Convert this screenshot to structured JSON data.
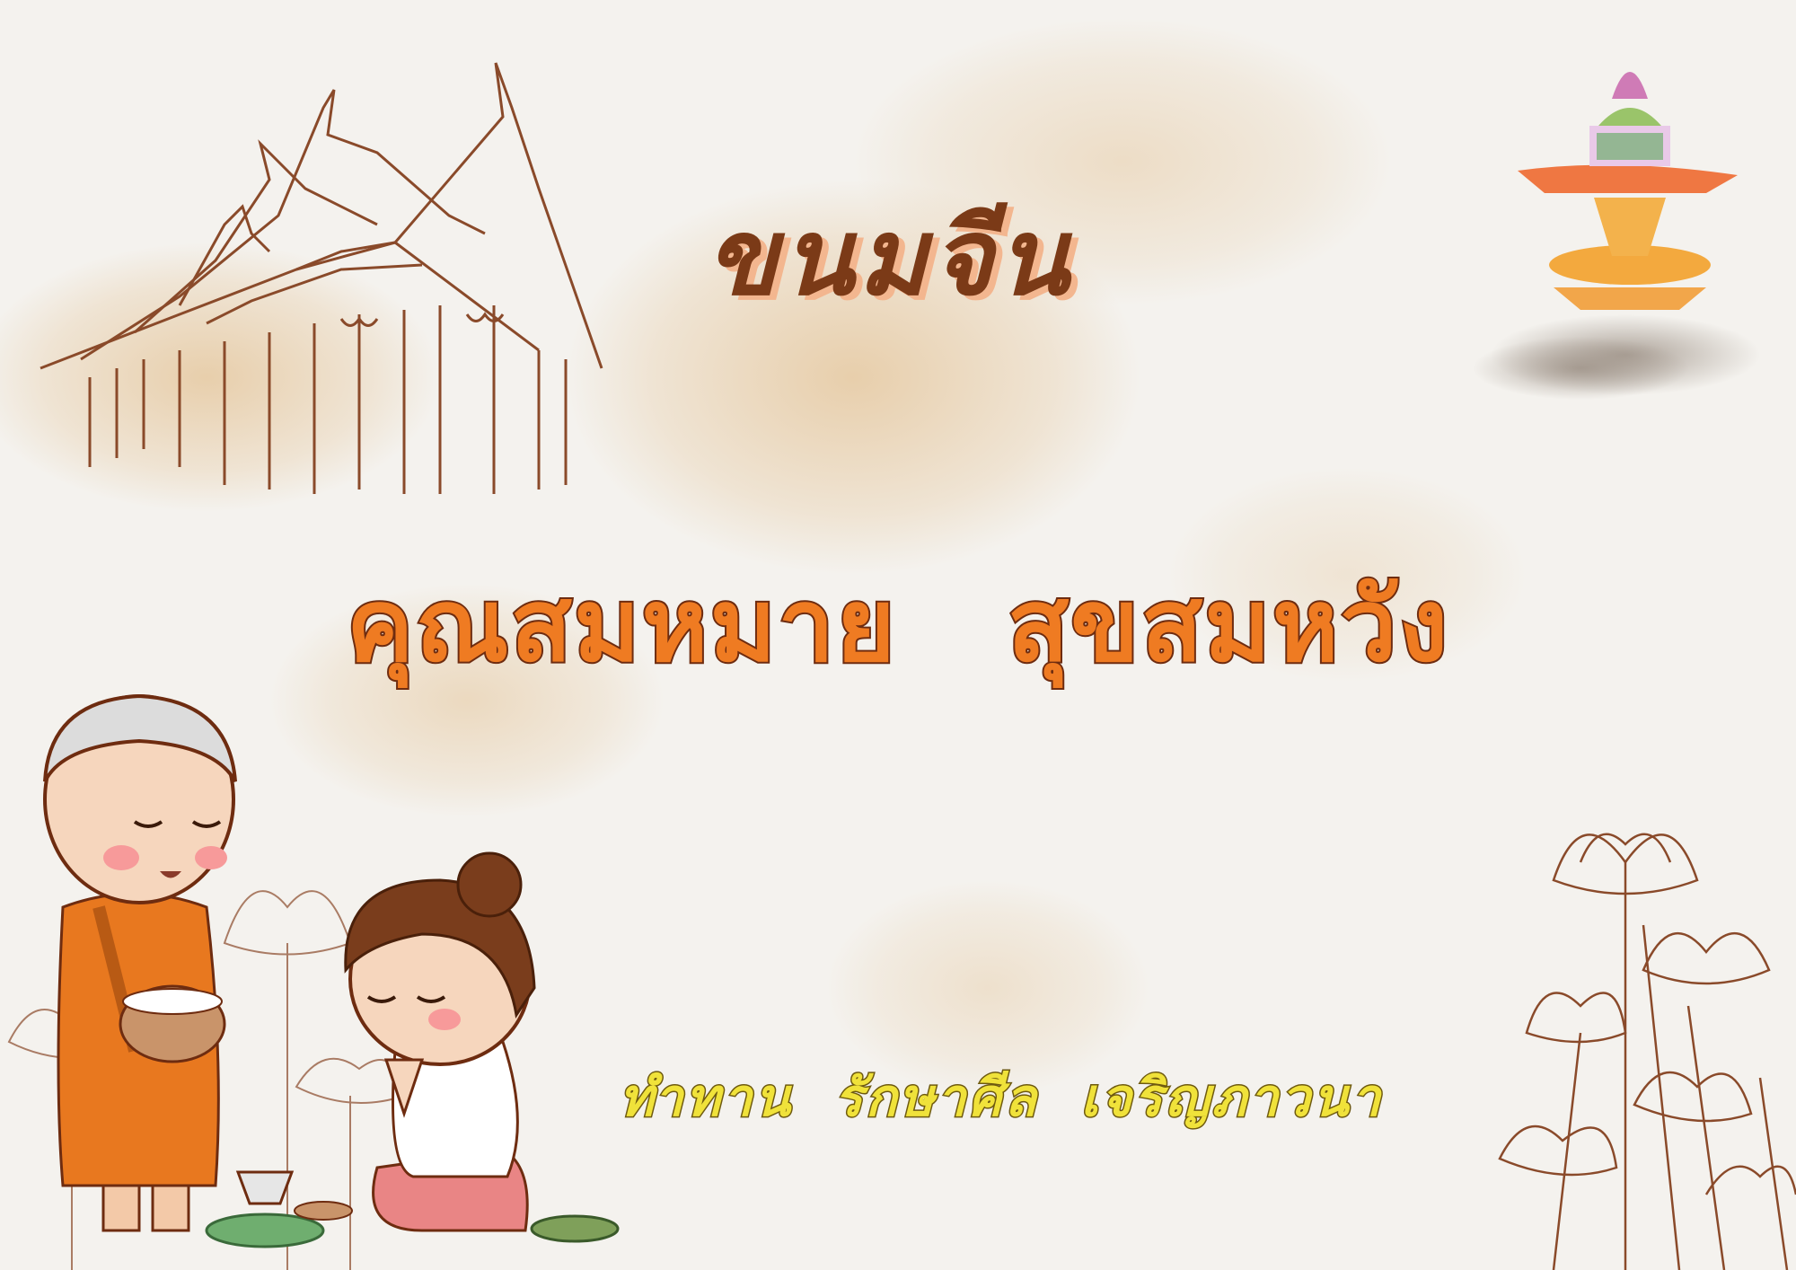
{
  "card": {
    "title": "ขนมจีน",
    "names": "คุณสมหมาย   สุขสมหวัง",
    "motto": "ทำทาน  รักษาศีล  เจริญภาวนา"
  },
  "colors": {
    "background": "#f4f2ee",
    "watercolor_stain": "#d9a35a",
    "title": "#7b3a17",
    "title_shadow": "#f3b68f",
    "names_fill": "#ef7b22",
    "names_outline": "#6e2c10",
    "motto_fill": "#f0e23a",
    "sketch_line": "#8a4a2a",
    "robe": "#e8781f"
  },
  "illustrations": {
    "temple": "temple-line-art",
    "offering": "pha-pa-offering-tray",
    "lotus": "lotus-flower-sketch",
    "monk": "monk-cartoon",
    "woman": "praying-woman-cartoon"
  }
}
